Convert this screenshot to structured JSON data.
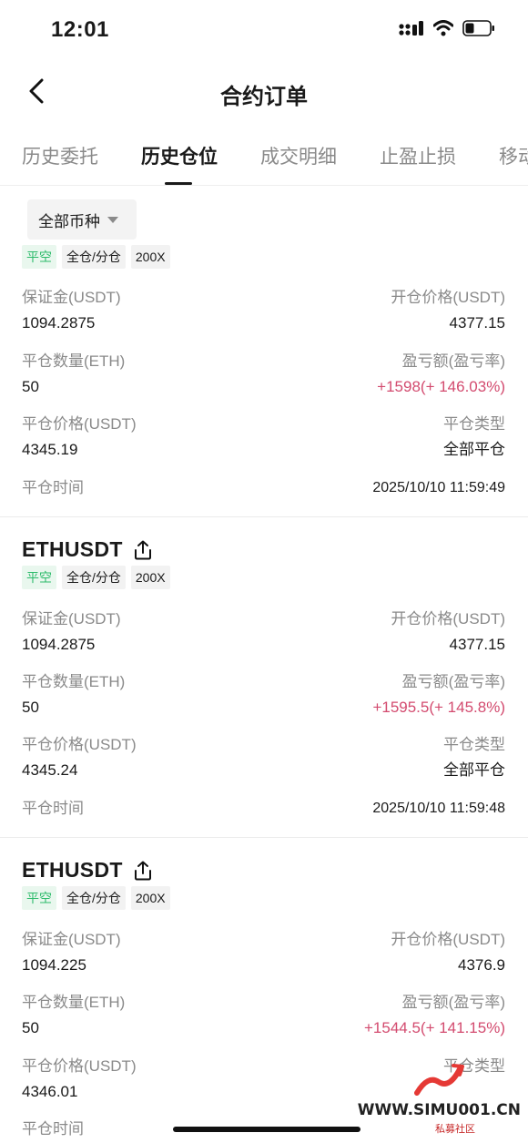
{
  "status_bar": {
    "time": "12:01"
  },
  "header": {
    "title": "合约订单"
  },
  "tabs": [
    {
      "label": "历史委托"
    },
    {
      "label": "历史仓位"
    },
    {
      "label": "成交明细"
    },
    {
      "label": "止盈止损"
    },
    {
      "label": "移动"
    }
  ],
  "filter": {
    "label": "全部币种"
  },
  "cards": [
    {
      "symbol": "",
      "tags": [
        "平空",
        "全仓/分仓",
        "200X"
      ],
      "margin_label": "保证金(USDT)",
      "margin": "1094.2875",
      "open_price_label": "开仓价格(USDT)",
      "open_price": "4377.15",
      "close_qty_label": "平仓数量(ETH)",
      "close_qty": "50",
      "pnl_label": "盈亏额(盈亏率)",
      "pnl": "+1598(+ 146.03%)",
      "close_price_label": "平仓价格(USDT)",
      "close_price": "4345.19",
      "close_type_label": "平仓类型",
      "close_type": "全部平仓",
      "close_time_label": "平仓时间",
      "close_time": "2025/10/10 11:59:49"
    },
    {
      "symbol": "ETHUSDT",
      "tags": [
        "平空",
        "全仓/分仓",
        "200X"
      ],
      "margin_label": "保证金(USDT)",
      "margin": "1094.2875",
      "open_price_label": "开仓价格(USDT)",
      "open_price": "4377.15",
      "close_qty_label": "平仓数量(ETH)",
      "close_qty": "50",
      "pnl_label": "盈亏额(盈亏率)",
      "pnl": "+1595.5(+ 145.8%)",
      "close_price_label": "平仓价格(USDT)",
      "close_price": "4345.24",
      "close_type_label": "平仓类型",
      "close_type": "全部平仓",
      "close_time_label": "平仓时间",
      "close_time": "2025/10/10 11:59:48"
    },
    {
      "symbol": "ETHUSDT",
      "tags": [
        "平空",
        "全仓/分仓",
        "200X"
      ],
      "margin_label": "保证金(USDT)",
      "margin": "1094.225",
      "open_price_label": "开仓价格(USDT)",
      "open_price": "4376.9",
      "close_qty_label": "平仓数量(ETH)",
      "close_qty": "50",
      "pnl_label": "盈亏额(盈亏率)",
      "pnl": "+1544.5(+ 141.15%)",
      "close_price_label": "平仓价格(USDT)",
      "close_price": "4346.01",
      "close_type_label": "平仓类型",
      "close_type": "",
      "close_time_label": "平仓时间",
      "close_time": ""
    }
  ],
  "watermark": {
    "text": "WWW.SIMU001.CN",
    "sub": "私募社区"
  },
  "colors": {
    "profit": "#d34b6f",
    "tag_green": "#2dbb6b"
  }
}
